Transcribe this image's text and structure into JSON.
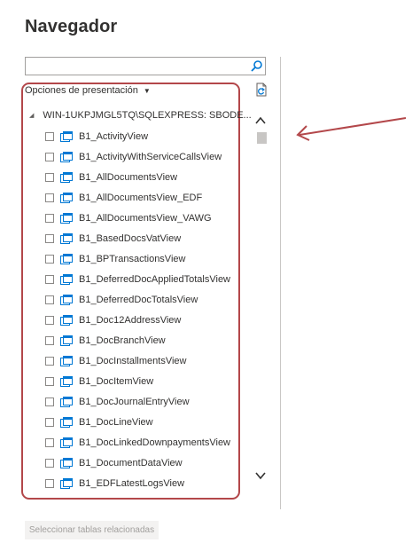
{
  "window": {
    "title": "Navegador"
  },
  "search": {
    "value": "",
    "placeholder": ""
  },
  "display_options": {
    "label": "Opciones de presentación"
  },
  "tree": {
    "root_label": "WIN-1UKPJMGL5TQ\\SQLEXPRESS: SBODE...",
    "items": [
      "B1_ActivityView",
      "B1_ActivityWithServiceCallsView",
      "B1_AllDocumentsView",
      "B1_AllDocumentsView_EDF",
      "B1_AllDocumentsView_VAWG",
      "B1_BasedDocsVatView",
      "B1_BPTransactionsView",
      "B1_DeferredDocAppliedTotalsView",
      "B1_DeferredDocTotalsView",
      "B1_Doc12AddressView",
      "B1_DocBranchView",
      "B1_DocInstallmentsView",
      "B1_DocItemView",
      "B1_DocJournalEntryView",
      "B1_DocLineView",
      "B1_DocLinkedDownpaymentsView",
      "B1_DocumentDataView",
      "B1_EDFLatestLogsView"
    ]
  },
  "footer": {
    "related_button": "Seleccionar tablas relacionadas"
  },
  "colors": {
    "highlight": "#b3474a",
    "accent": "#0078d4",
    "db_icon": "#e8a317"
  },
  "icons": [
    "search-icon",
    "refresh-icon",
    "database-icon",
    "view-icon",
    "chevron-up-icon",
    "chevron-down-icon",
    "arrow-annotation-icon"
  ]
}
